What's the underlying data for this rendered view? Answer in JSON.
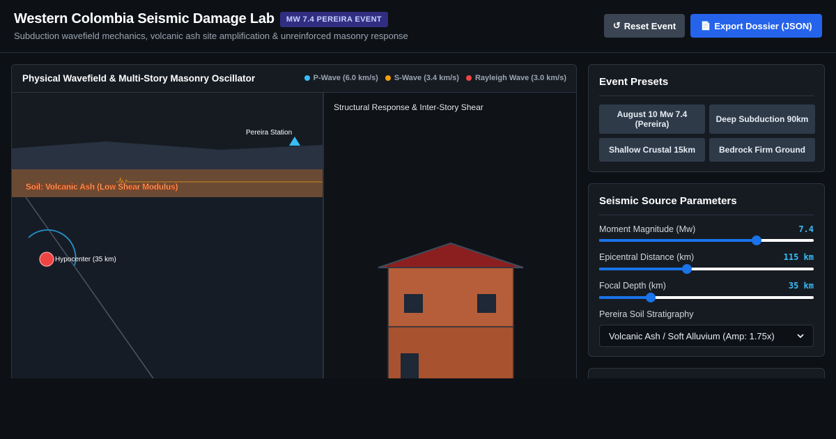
{
  "header": {
    "title": "Western Colombia Seismic Damage Lab",
    "badge": "MW 7.4 PEREIRA EVENT",
    "subtitle": "Subduction wavefield mechanics, volcanic ash site amplification & unreinforced masonry response",
    "reset_label": "Reset Event",
    "export_label": "Export Dossier (JSON)",
    "reset_icon": "↺",
    "export_icon": "📄"
  },
  "viz": {
    "title": "Physical Wavefield & Multi-Story Masonry Oscillator",
    "legend": [
      {
        "label": "P-Wave (6.0 km/s)",
        "color": "#38bdf8"
      },
      {
        "label": "S-Wave (3.4 km/s)",
        "color": "#f59e0b"
      },
      {
        "label": "Rayleigh Wave (3.0 km/s)",
        "color": "#ef4444"
      }
    ],
    "station_label": "Pereira Station",
    "soil_label": "Soil: Volcanic Ash (Low Shear Modulus)",
    "hypocenter_label": "Hypocenter (35 km)",
    "structure_title": "Structural Response & Inter-Story Shear"
  },
  "presets": {
    "title": "Event Presets",
    "items": [
      {
        "label": "August 10 Mw 7.4 (Pereira)"
      },
      {
        "label": "Deep Subduction 90km"
      },
      {
        "label": "Shallow Crustal 15km"
      },
      {
        "label": "Bedrock Firm Ground"
      }
    ]
  },
  "params": {
    "title": "Seismic Source Parameters",
    "magnitude": {
      "label": "Moment Magnitude (Mw)",
      "value": "7.4",
      "fraction": 0.733
    },
    "distance": {
      "label": "Epicentral Distance (km)",
      "value": "115 km",
      "fraction": 0.41
    },
    "depth": {
      "label": "Focal Depth (km)",
      "value": "35 km",
      "fraction": 0.24
    },
    "soil": {
      "label": "Pereira Soil Stratigraphy",
      "selected": "Volcanic Ash / Soft Alluvium (Amp: 1.75x)"
    }
  },
  "colors": {
    "accent": "#2563eb",
    "badge_bg": "#312e81",
    "value_text": "#38bdf8",
    "brick": "#b65d3a",
    "roof": "#8b1f1f",
    "hypocenter": "#ef4444",
    "soil": "#6b4a34"
  }
}
